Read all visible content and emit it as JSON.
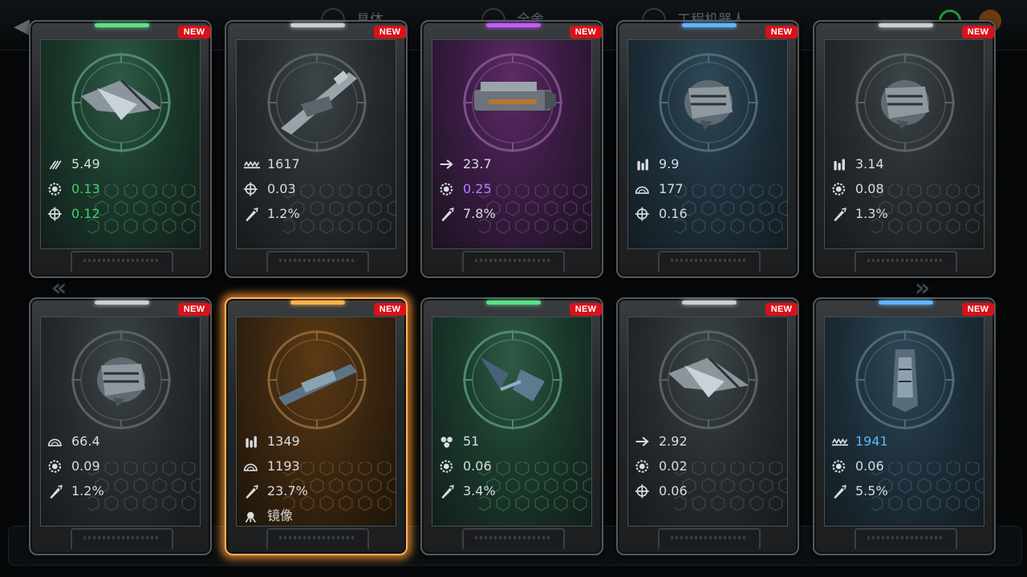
{
  "colors": {
    "green_value": "#3fd06a",
    "purple_value": "#b87bff",
    "blue_value": "#5ab8ff",
    "selected_glow": "#ffb35a"
  },
  "background": {
    "tabs": [
      "具体",
      "全舍",
      "工程机器人"
    ]
  },
  "cards": [
    {
      "new": "NEW",
      "rarity": "green",
      "ship": "fighter",
      "stats": [
        {
          "icon": "speed-arrows-icon",
          "value": "5.49",
          "color": "default"
        },
        {
          "icon": "gear-icon",
          "value": "0.13",
          "color": "green"
        },
        {
          "icon": "crosshair-icon",
          "value": "0.12",
          "color": "green"
        }
      ]
    },
    {
      "new": "NEW",
      "rarity": "gray",
      "ship": "cannon",
      "stats": [
        {
          "icon": "wave-damage-icon",
          "value": "1617",
          "color": "default"
        },
        {
          "icon": "crosshair-icon",
          "value": "0.03",
          "color": "default"
        },
        {
          "icon": "missile-icon",
          "value": "1.2%",
          "color": "default"
        }
      ]
    },
    {
      "new": "NEW",
      "rarity": "purple",
      "ship": "cruiser",
      "stats": [
        {
          "icon": "arrow-right-icon",
          "value": "23.7",
          "color": "default"
        },
        {
          "icon": "gear-icon",
          "value": "0.25",
          "color": "purple"
        },
        {
          "icon": "missile-icon",
          "value": "7.8%",
          "color": "default"
        }
      ]
    },
    {
      "new": "NEW",
      "rarity": "blue",
      "ship": "pod",
      "stats": [
        {
          "icon": "ammo-icon",
          "value": "9.9",
          "color": "default"
        },
        {
          "icon": "dome-shield-icon",
          "value": "177",
          "color": "default"
        },
        {
          "icon": "crosshair-icon",
          "value": "0.16",
          "color": "default"
        }
      ]
    },
    {
      "new": "NEW",
      "rarity": "gray",
      "ship": "pod",
      "stats": [
        {
          "icon": "ammo-icon",
          "value": "3.14",
          "color": "default"
        },
        {
          "icon": "gear-icon",
          "value": "0.08",
          "color": "default"
        },
        {
          "icon": "missile-icon",
          "value": "1.3%",
          "color": "default"
        }
      ]
    },
    {
      "new": "NEW",
      "rarity": "gray",
      "ship": "pod",
      "stats": [
        {
          "icon": "dome-shield-icon",
          "value": "66.4",
          "color": "default"
        },
        {
          "icon": "gear-icon",
          "value": "0.09",
          "color": "default"
        },
        {
          "icon": "missile-icon",
          "value": "1.2%",
          "color": "default"
        }
      ]
    },
    {
      "new": "NEW",
      "rarity": "orange",
      "ship": "cannon2",
      "selected": true,
      "stats": [
        {
          "icon": "ammo-icon",
          "value": "1349",
          "color": "default"
        },
        {
          "icon": "dome-shield-icon",
          "value": "1193",
          "color": "default"
        },
        {
          "icon": "missile-icon",
          "value": "23.7%",
          "color": "default"
        },
        {
          "icon": "mirror-icon",
          "value": "镜像",
          "color": "default"
        }
      ]
    },
    {
      "new": "NEW",
      "rarity": "green",
      "ship": "drone",
      "stats": [
        {
          "icon": "cluster-icon",
          "value": "51",
          "color": "default"
        },
        {
          "icon": "gear-icon",
          "value": "0.06",
          "color": "default"
        },
        {
          "icon": "missile-icon",
          "value": "3.4%",
          "color": "default"
        }
      ]
    },
    {
      "new": "NEW",
      "rarity": "gray",
      "ship": "fighter",
      "stats": [
        {
          "icon": "arrow-right-icon",
          "value": "2.92",
          "color": "default"
        },
        {
          "icon": "gear-icon",
          "value": "0.02",
          "color": "default"
        },
        {
          "icon": "crosshair-icon",
          "value": "0.06",
          "color": "default"
        }
      ]
    },
    {
      "new": "NEW",
      "rarity": "blue",
      "ship": "capsule",
      "stats": [
        {
          "icon": "wave-damage-icon",
          "value": "1941",
          "color": "blue"
        },
        {
          "icon": "gear-icon",
          "value": "0.06",
          "color": "default"
        },
        {
          "icon": "missile-icon",
          "value": "5.5%",
          "color": "default"
        }
      ]
    }
  ]
}
